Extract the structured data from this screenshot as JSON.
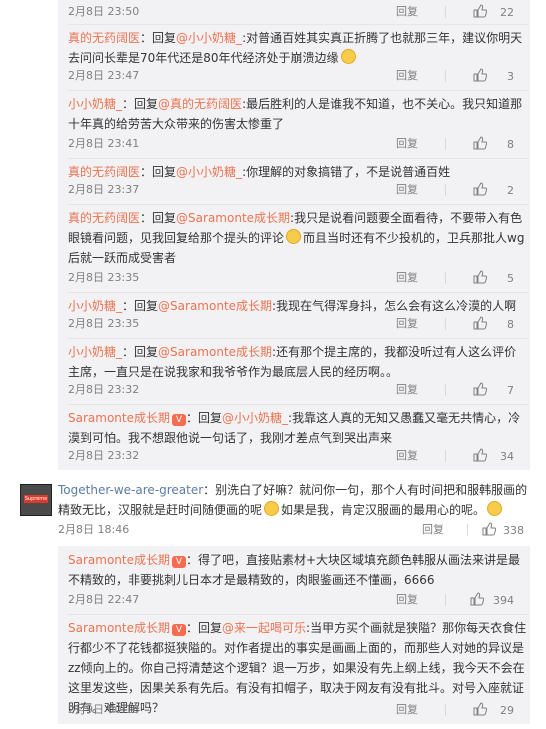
{
  "ui": {
    "reply_label": "回复",
    "reply_word": "回复",
    "colon": "：",
    "colon_ascii": ":"
  },
  "replies_a": [
    {
      "text_before": "",
      "name": "",
      "time": "2月8日 23:50",
      "likes": "22"
    },
    {
      "name": "真的无药阔医",
      "reply_to": "@小小奶糖_",
      "body": "对普通百姓其实真正折腾了也就那三年，建议你明天去问问长辈是70年代还是80年代经济处于崩溃边缘",
      "time": "2月8日 23:47",
      "likes": "3"
    },
    {
      "name": "小小奶糖_",
      "reply_to": "@真的无药阔医",
      "body": "最后胜利的人是谁我不知道，也不关心。我只知道那十年真的给劳苦大众带来的伤害太惨重了",
      "time": "2月8日 23:41",
      "likes": "8"
    },
    {
      "name": "真的无药阔医",
      "reply_to": "@小小奶糖_",
      "body": "你理解的对象搞错了，不是说普通百姓",
      "time": "2月8日 23:37",
      "likes": "2"
    },
    {
      "name": "真的无药阔医",
      "reply_to": "@Saramonte成长期",
      "body_1": "我只是说看问题要全面看待，不要带入有色眼镜看问题，见我回复给那个提头的评论",
      "body_2": "而且当时还有不少投机的，卫兵那批人wg后就一跃而成受害者",
      "time": "2月8日 23:35",
      "likes": "5"
    },
    {
      "name": "小小奶糖_",
      "reply_to": "@Saramonte成长期",
      "body": "我现在气得浑身抖，怎么会有这么冷漠的人啊",
      "time": "2月8日 23:35",
      "likes": "8"
    },
    {
      "name": "小小奶糖_",
      "reply_to": "@Saramonte成长期",
      "body": "还有那个提主席的，我都没听过有人这么评价主席，一直只是在说我家和我爷爷作为最底层人民的经历啊。。",
      "time": "2月8日 23:32",
      "likes": "7"
    },
    {
      "name": "Saramonte成长期",
      "badge": "V",
      "reply_to": "@小小奶糖_",
      "body": "我靠这人真的无知又愚蠢又毫无共情心，冷漠到可怕。我不想跟他说一句话了，我刚才差点气到哭出声来",
      "time": "2月8日 23:32",
      "likes": "34"
    }
  ],
  "top_comment": {
    "avatar_label": "Supreme",
    "name": "Together-we-are-greater",
    "body_1": "别洗白了好嘛？就问你一句，那个人有时间把和服韩服画的精致无比，汉服就是赶时间随便画的呢",
    "body_2": "如果是我，肯定汉服画的最用心的呢。",
    "time": "2月8日 18:46",
    "likes": "338"
  },
  "replies_b": [
    {
      "name": "Saramonte成长期",
      "badge": "V",
      "body": "得了吧，直接贴素材+大块区域填充颜色韩服从画法来讲是最不精致的，非要挑刺儿日本才是最精致的，肉眼鉴画还不懂画，6666",
      "time": "2月8日 22:47",
      "likes": "394"
    },
    {
      "name": "Saramonte成长期",
      "badge": "V",
      "reply_to": "@来一起喝可乐",
      "body": "当甲方买个画就是狭隘？那你每天衣食住行都少不了花钱都挺狭隘的。对作者提出的事实是画画上面的，而那些人对她的异议是zz倾向上的。你自己捋清楚这个逻辑？退一万步，如果没有先上纲上线，我今天不会在这里发这些，因果关系有先后。有没有扣帽子，取决于网友有没有批斗。对号入座就证明有。难理解吗？",
      "time": "2月9日 00:18",
      "likes": "29"
    }
  ]
}
